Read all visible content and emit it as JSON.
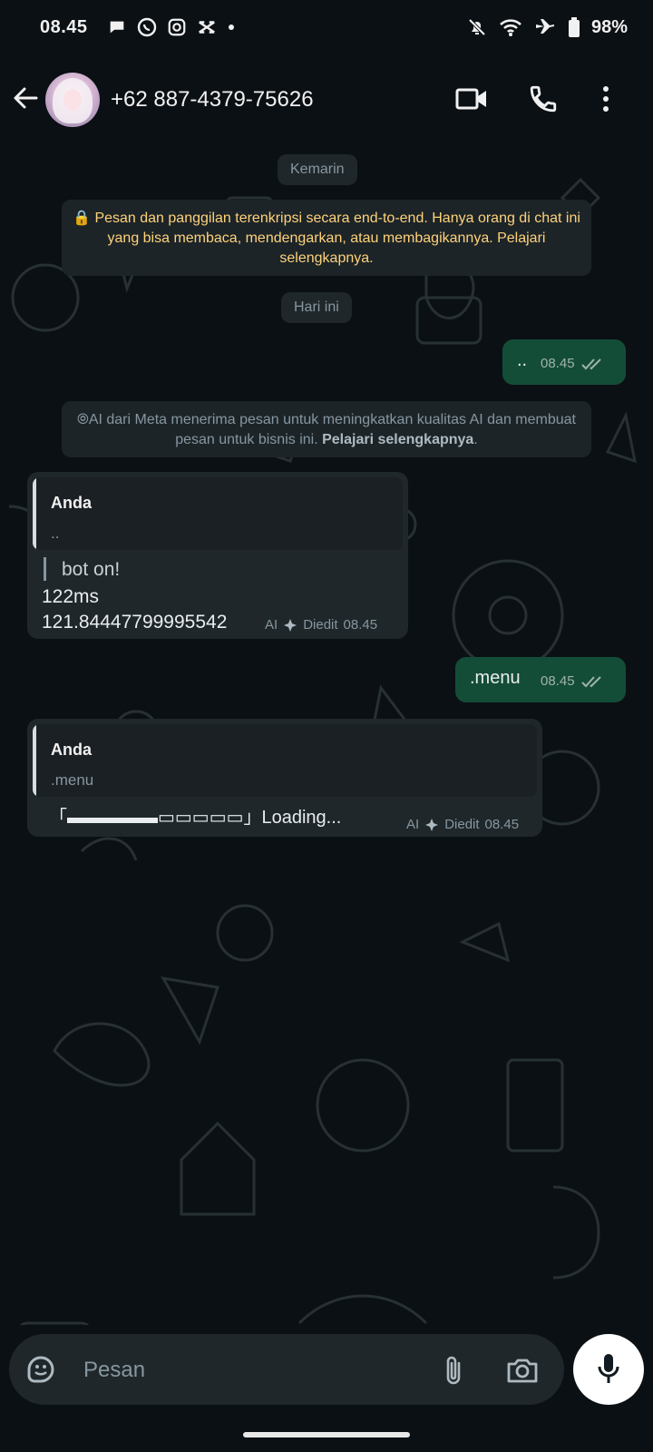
{
  "status_bar": {
    "time": "08.45",
    "battery": "98%"
  },
  "header": {
    "contact": "+62 887-4379-75626"
  },
  "chat": {
    "date_yesterday": "Kemarin",
    "encryption_notice": "🔒 Pesan dan panggilan terenkripsi secara end-to-end. Hanya orang di chat ini yang bisa membaca, mendengarkan, atau membagikannya. Pelajari selengkapnya.",
    "date_today": "Hari ini",
    "msg1": {
      "text": "..",
      "time": "08.45"
    },
    "ai_notice": {
      "text": "AI dari Meta menerima pesan untuk meningkatkan kualitas AI dan membuat pesan untuk bisnis ini.",
      "link": "Pelajari selengkapnya"
    },
    "reply1": {
      "quote_name": "Anda",
      "quote_text": "..",
      "line1": "bot on!",
      "line2": "122ms",
      "line3": "121.84447799995542",
      "ai_label": "AI",
      "edited": "Diedit",
      "time": "08.45"
    },
    "msg2": {
      "text": ".menu",
      "time": "08.45"
    },
    "reply2": {
      "quote_name": "Anda",
      "quote_text": ".menu",
      "loading": "「▬▬▬▬▬▭▭▭▭▭」Loading...",
      "ai_label": "AI",
      "edited": "Diedit",
      "time": "08.45"
    }
  },
  "composer": {
    "placeholder": "Pesan"
  },
  "colors": {
    "background": "#0b1014",
    "outgoing_bubble": "#144d37",
    "incoming_bubble": "#1f272a",
    "notice_yellow": "#ffd279",
    "read_ticks": "#9fb3ad"
  }
}
